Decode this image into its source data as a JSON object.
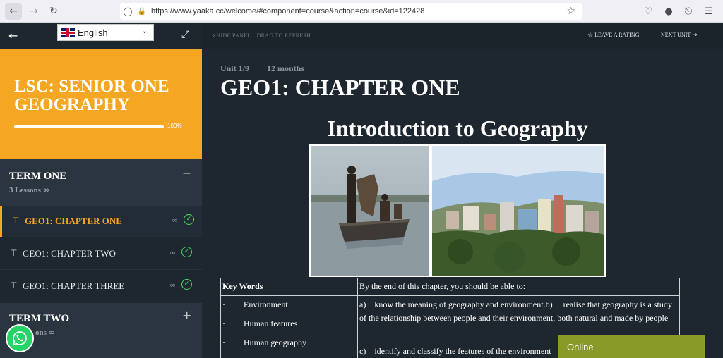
{
  "browser": {
    "url": "https://www.yaaka.cc/welcome/#component=course&action=course&id=122428"
  },
  "sidebar": {
    "language": "English",
    "course_title": "LSC: SENIOR ONE GEOGRAPHY",
    "progress_percent": 100,
    "progress_label": "100%",
    "terms": [
      {
        "title": "TERM ONE",
        "meta": "3 Lessons",
        "expanded": true,
        "toggle": "−",
        "lessons": [
          {
            "title": "GEO1: CHAPTER ONE",
            "active": true,
            "completed": true
          },
          {
            "title": "GEO1: CHAPTER TWO",
            "active": false,
            "completed": true
          },
          {
            "title": "GEO1: CHAPTER THREE",
            "active": false,
            "completed": true
          }
        ]
      },
      {
        "title": "TERM TWO",
        "meta": "ons",
        "expanded": false,
        "toggle": "+"
      }
    ]
  },
  "topbar": {
    "hide_panel": "HIDE PANEL",
    "drag_refresh": "DRAG TO REFRESH",
    "rating": "LEAVE A RATING",
    "next_unit": "NEXT UNIT"
  },
  "content": {
    "unit_label": "Unit 1/9",
    "duration": "12 months",
    "chapter_title": "GEO1: CHAPTER ONE",
    "intro_heading": "Introduction to Geography",
    "table": {
      "keywords_header": "Key Words",
      "objectives_header": "By the end of this chapter, you should be able to:",
      "keywords": [
        "Environment",
        "Human features",
        "Human geography"
      ],
      "bullet": "·",
      "objectives": [
        "a)    know the meaning of geography and environment.b)     realise that geography is a study of the relationship between people and their environment, both natural and made by people",
        "c)    identify and classify the features of the environment"
      ]
    }
  },
  "chat": {
    "status": "Online"
  },
  "colors": {
    "accent": "#f5a623",
    "sidebar_bg": "#1e2730",
    "check": "#4cd964",
    "chat": "#8a9a28"
  }
}
